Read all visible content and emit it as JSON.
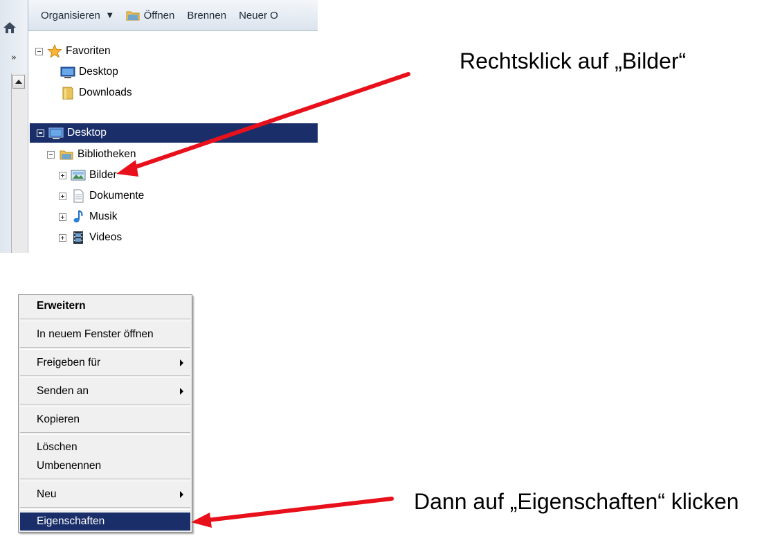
{
  "toolbar": {
    "organize": "Organisieren",
    "open": "Öffnen",
    "burn": "Brennen",
    "new": "Neuer O"
  },
  "nav": {
    "overflow": "»"
  },
  "tree": {
    "favorites": "Favoriten",
    "fav_desktop": "Desktop",
    "fav_downloads": "Downloads",
    "desktop": "Desktop",
    "libraries": "Bibliotheken",
    "pictures": "Bilder",
    "documents": "Dokumente",
    "music": "Musik",
    "videos": "Videos"
  },
  "annotations": {
    "step1": "Rechtsklick auf „Bilder“",
    "step2": "Dann auf „Eigenschaften“ klicken",
    "arrow_color": "#e8111b"
  },
  "context_menu": {
    "expand": "Erweitern",
    "open_new_window": "In neuem Fenster öffnen",
    "share_with": "Freigeben für",
    "send_to": "Senden an",
    "copy": "Kopieren",
    "delete": "Löschen",
    "rename": "Umbenennen",
    "new": "Neu",
    "properties": "Eigenschaften"
  },
  "colors": {
    "selection": "#1a2f6a",
    "menu_bg": "#f0f0f0"
  }
}
